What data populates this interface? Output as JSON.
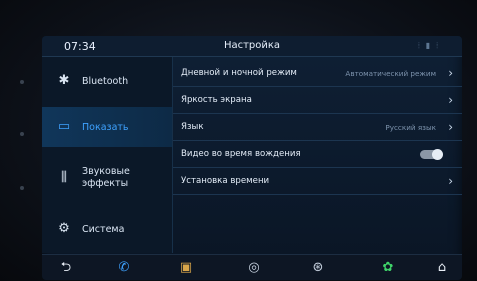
{
  "status": {
    "time": "07:34",
    "title": "Настройка"
  },
  "sidebar": {
    "items": [
      {
        "label": "Bluetooth",
        "icon": "bluetooth-icon",
        "glyph": "✱"
      },
      {
        "label": "Показать",
        "icon": "display-icon",
        "glyph": "▭"
      },
      {
        "label": "Звуковые эффекты",
        "icon": "equalizer-icon",
        "glyph": "⫼"
      },
      {
        "label": "Система",
        "icon": "gear-icon",
        "glyph": "⚙"
      }
    ],
    "active_index": 1,
    "accent": "#3ea2ff"
  },
  "settings": {
    "rows": [
      {
        "label": "Дневной и ночной режим",
        "value": "Автоматический режим",
        "control": "chevron"
      },
      {
        "label": "Яркость экрана",
        "value": "",
        "control": "chevron"
      },
      {
        "label": "Язык",
        "value": "Русский язык",
        "control": "chevron"
      },
      {
        "label": "Видео во время вождения",
        "value": "",
        "control": "toggle",
        "toggle_on": true
      },
      {
        "label": "Установка времени",
        "value": "",
        "control": "chevron"
      }
    ]
  },
  "bottom_bar": {
    "buttons": [
      {
        "icon": "back-icon",
        "glyph": "⮌",
        "color": "#e8eef6"
      },
      {
        "icon": "phone-icon",
        "glyph": "✆",
        "color": "#3ea2ff"
      },
      {
        "icon": "radio-icon",
        "glyph": "▣",
        "color": "#d9a64a"
      },
      {
        "icon": "music-icon",
        "glyph": "◎",
        "color": "#c9d4e2"
      },
      {
        "icon": "steering-wheel-icon",
        "glyph": "⊛",
        "color": "#c9d4e2"
      },
      {
        "icon": "settings-icon",
        "glyph": "✿",
        "color": "#3fd46a"
      },
      {
        "icon": "home-icon",
        "glyph": "⌂",
        "color": "#e8eef6"
      }
    ]
  }
}
